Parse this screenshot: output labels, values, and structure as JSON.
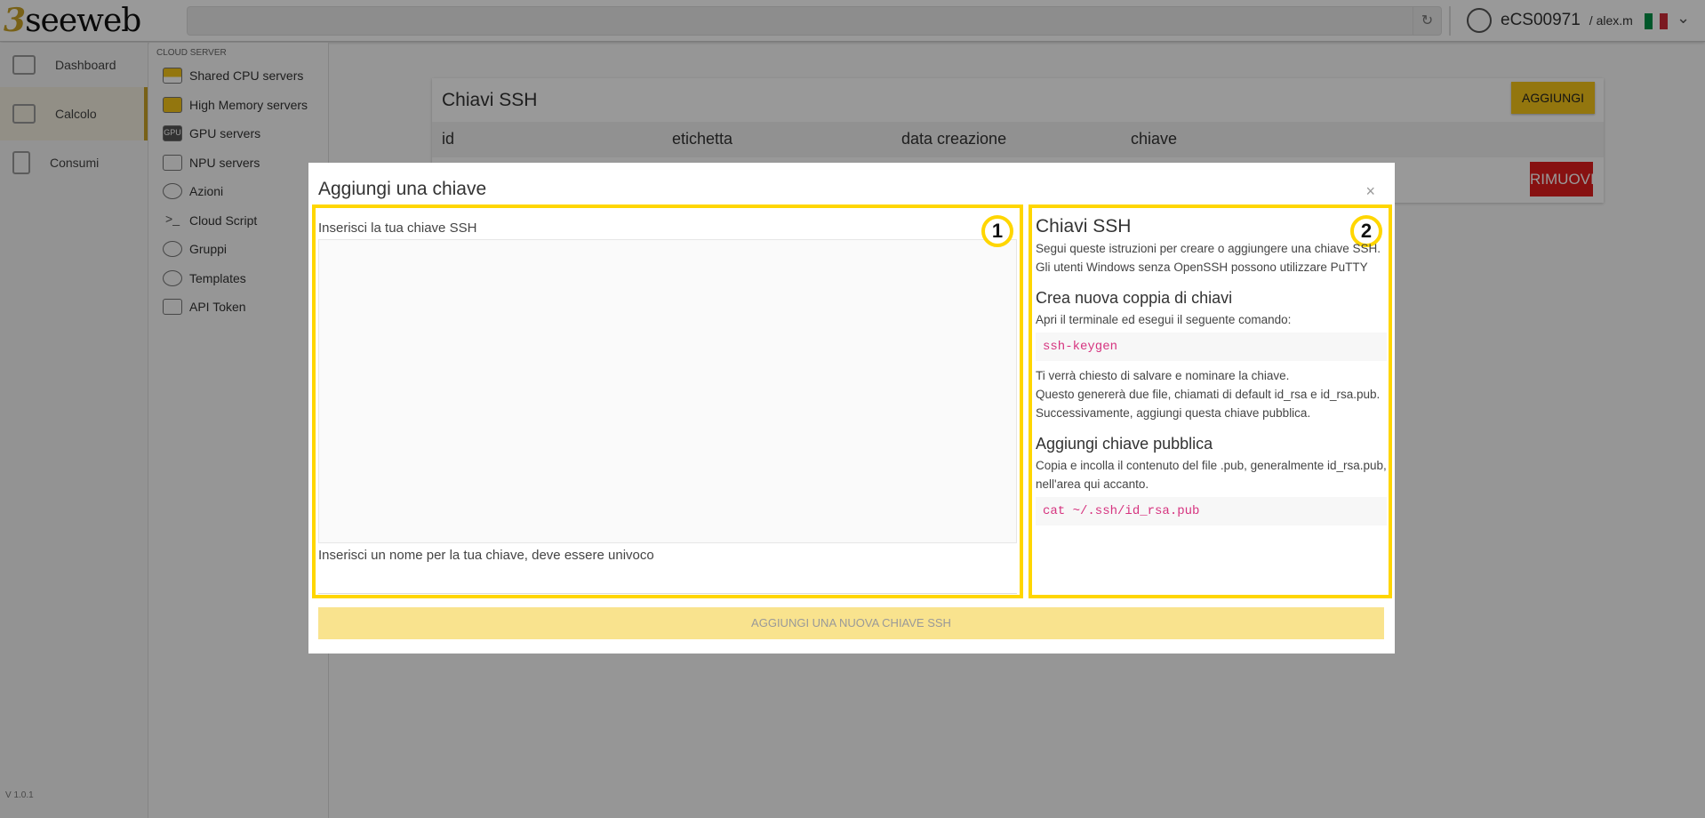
{
  "header": {
    "logo": "seeweb",
    "url": "",
    "account": "eCS00971",
    "user": "/ alex.m"
  },
  "sidebar": {
    "items": [
      {
        "label": "Dashboard"
      },
      {
        "label": "Calcolo"
      },
      {
        "label": "Consumi"
      }
    ],
    "version": "V 1.0.1"
  },
  "submenu": {
    "heading": "CLOUD SERVER",
    "items": [
      {
        "label": "Shared CPU servers",
        "icon": "GPU"
      },
      {
        "label": "High Memory servers"
      },
      {
        "label": "GPU servers",
        "icon": "GPU"
      },
      {
        "label": "NPU servers"
      },
      {
        "label": "Azioni"
      },
      {
        "label": "Cloud Script",
        "icon": ">_"
      },
      {
        "label": "Gruppi"
      },
      {
        "label": "Templates"
      },
      {
        "label": "API Token"
      }
    ]
  },
  "card": {
    "title": "Chiavi SSH",
    "add_label": "AGGIUNGI",
    "columns": [
      "id",
      "etichetta",
      "data creazione",
      "chiave"
    ],
    "remove_label": "RIMUOVI"
  },
  "modal": {
    "title": "Aggiungi una chiave",
    "close": "×",
    "key_label": "Inserisci la tua chiave SSH",
    "name_label": "Inserisci un nome per la tua chiave, deve essere univoco",
    "submit_label": "AGGIUNGI UNA NUOVA CHIAVE SSH",
    "help": {
      "title": "Chiavi SSH",
      "intro": "Segui queste istruzioni per creare o aggiungere una chiave SSH. Gli utenti Windows senza OpenSSH possono utilizzare PuTTY",
      "h1": "Crea nuova coppia di chiavi",
      "p1": "Apri il terminale ed esegui il seguente comando:",
      "code1": "ssh-keygen",
      "p2a": "Ti verrà chiesto di salvare e nominare la chiave.",
      "p2b": "Questo genererà due file, chiamati di default id_rsa e id_rsa.pub. Successivamente, aggiungi questa chiave pubblica.",
      "h2": "Aggiungi chiave pubblica",
      "p3": "Copia e incolla il contenuto del file .pub, generalmente id_rsa.pub, nell'area qui accanto.",
      "code2": "cat ~/.ssh/id_rsa.pub"
    }
  },
  "annotations": [
    "1",
    "2"
  ],
  "colors": {
    "accent": "#f5c518",
    "danger": "#e21d1d",
    "highlight": "#ffd600",
    "code": "#d6337f"
  }
}
